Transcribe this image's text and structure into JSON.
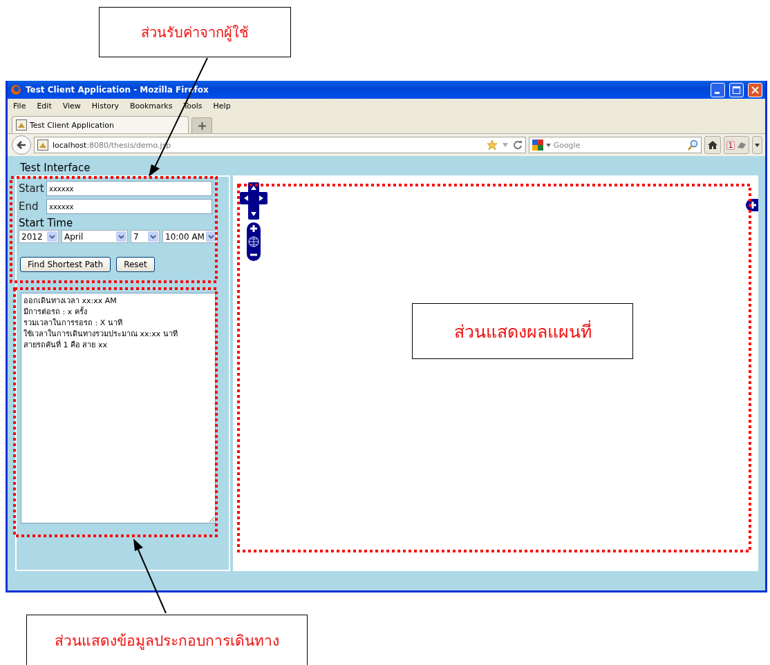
{
  "callouts": [
    {
      "text": "ส่วนรับค่าจากผู้ใช้"
    },
    {
      "text": "ส่วนแสดงผลแผนที่"
    },
    {
      "text": "ส่วนแสดงข้อมูลประกอบการเดินทาง"
    }
  ],
  "window": {
    "title": "Test Client Application - Mozilla Firefox",
    "menu": [
      "File",
      "Edit",
      "View",
      "History",
      "Bookmarks",
      "Tools",
      "Help"
    ],
    "tabs": [
      {
        "label": "Test Client Application",
        "selected": true
      }
    ],
    "url": {
      "host": "localhost",
      "path": ":8080/thesis/demo.jsp"
    },
    "search": {
      "placeholder": "Google"
    },
    "badge": "1"
  },
  "page": {
    "heading": "Test Interface",
    "fields": [
      {
        "label": "Start",
        "value": "xxxxxx"
      },
      {
        "label": "End",
        "value": "xxxxxx"
      }
    ],
    "start_time_label": "Start Time",
    "selects": [
      {
        "value": "2012"
      },
      {
        "value": "April"
      },
      {
        "value": "7"
      },
      {
        "value": "10:00 AM"
      }
    ],
    "buttons": [
      "Find Shortest Path",
      "Reset"
    ],
    "result_lines": [
      "ออกเดินทางเวลา xx:xx AM",
      "มีการต่อรถ : x ครั้ง",
      "รวมเวลาในการรอรถ : X นาที",
      "ใช้เวลาในการเดินทางรวมประมาณ xx:xx นาที",
      "สายรถคันที่ 1 คือ สาย xx"
    ]
  }
}
